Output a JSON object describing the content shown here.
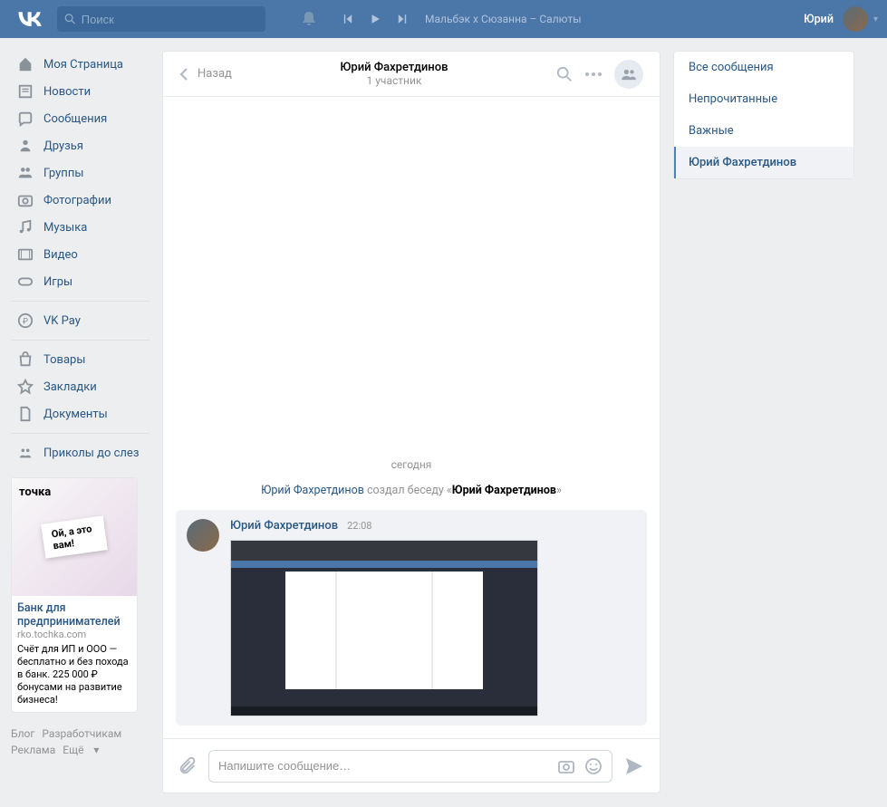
{
  "header": {
    "search_placeholder": "Поиск",
    "now_playing": "Мальбэк x Сюзанна – Салюты",
    "user_name": "Юрий"
  },
  "sidebar": {
    "items": [
      {
        "label": "Моя Страница"
      },
      {
        "label": "Новости"
      },
      {
        "label": "Сообщения"
      },
      {
        "label": "Друзья"
      },
      {
        "label": "Группы"
      },
      {
        "label": "Фотографии"
      },
      {
        "label": "Музыка"
      },
      {
        "label": "Видео"
      },
      {
        "label": "Игры"
      }
    ],
    "extra1": [
      {
        "label": "VK Pay"
      }
    ],
    "extra2": [
      {
        "label": "Товары"
      },
      {
        "label": "Закладки"
      },
      {
        "label": "Документы"
      }
    ],
    "extra3": [
      {
        "label": "Приколы до слез"
      }
    ]
  },
  "ad": {
    "brand": "точка",
    "tagline": "Ой, а это вам!",
    "title": "Банк для предпринимателей",
    "link": "rko.tochka.com",
    "desc": "Счёт для ИП и ООО — бесплатно и без похода в банк. 225 000 ₽ бонусами на развитие бизнеса!"
  },
  "footer": {
    "blog": "Блог",
    "devs": "Разработчикам",
    "ads": "Реклама",
    "more": "Ещё"
  },
  "chat": {
    "back": "Назад",
    "title": "Юрий Фахретдинов",
    "subtitle": "1 участник",
    "date": "сегодня",
    "system_prefix": "Юрий Фахретдинов",
    "system_mid": " создал беседу «",
    "system_name": "Юрий Фахретдинов",
    "system_suffix": "»",
    "author": "Юрий Фахретдинов",
    "time": "22:08",
    "input_placeholder": "Напишите сообщение…"
  },
  "filters": {
    "all": "Все сообщения",
    "unread": "Непрочитанные",
    "important": "Важные",
    "active": "Юрий Фахретдинов"
  }
}
